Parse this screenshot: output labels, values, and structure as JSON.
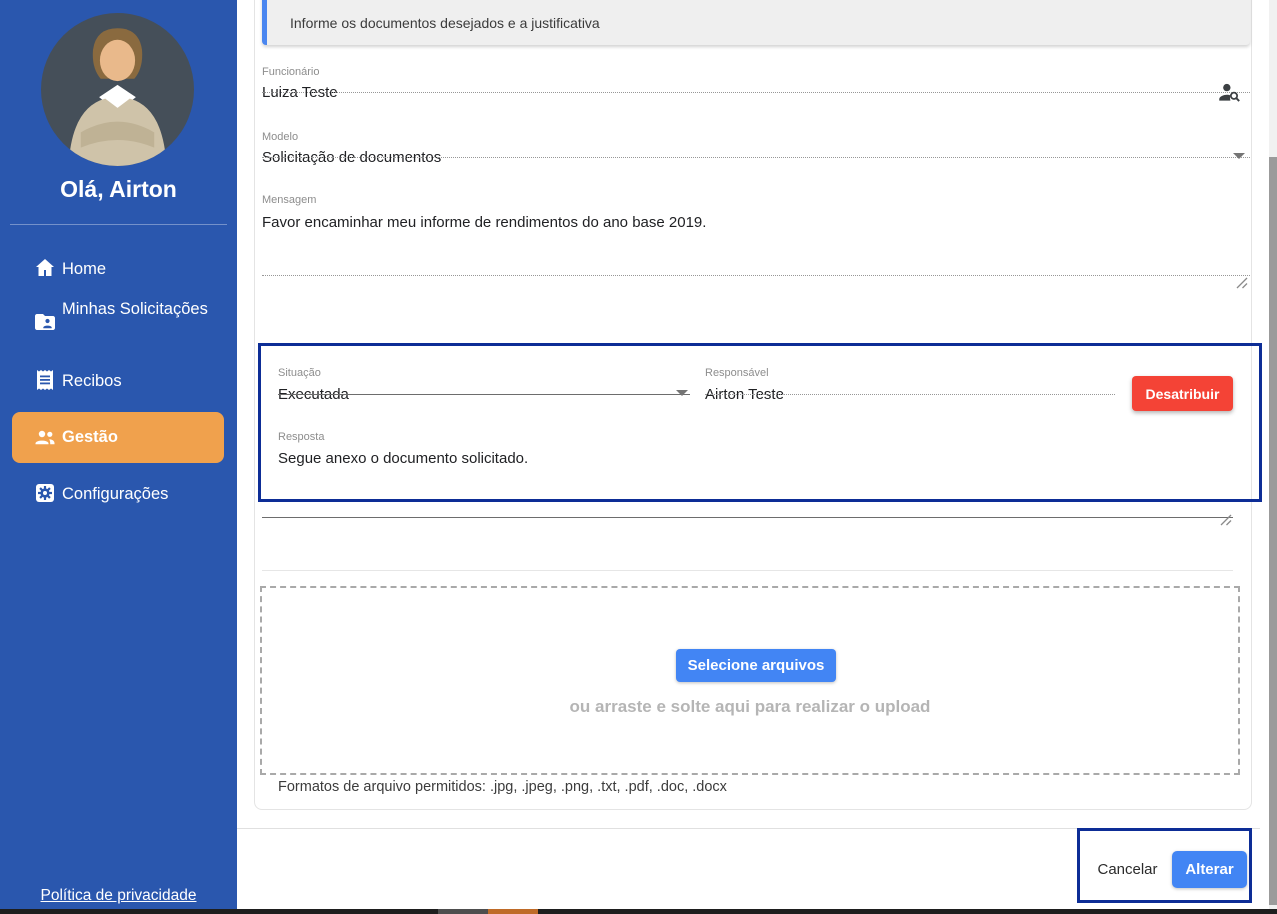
{
  "sidebar": {
    "greeting": "Olá, Airton",
    "items": [
      {
        "label": "Home",
        "icon": "home-icon",
        "active": false
      },
      {
        "label": "Minhas Solicitações",
        "icon": "folder-shared-icon",
        "active": false
      },
      {
        "label": "Recibos",
        "icon": "receipt-icon",
        "active": false
      },
      {
        "label": "Gestão",
        "icon": "people-icon",
        "active": true
      },
      {
        "label": "Configurações",
        "icon": "settings-icon",
        "active": false
      }
    ],
    "privacy_link": "Política de privacidade"
  },
  "banner": {
    "text": "Informe os documentos desejados e a justificativa"
  },
  "form": {
    "funcionario": {
      "label": "Funcionário",
      "value": "Luiza Teste",
      "icon": "person-search-icon"
    },
    "modelo": {
      "label": "Modelo",
      "value": "Solicitação de documentos"
    },
    "mensagem": {
      "label": "Mensagem",
      "value": "Favor encaminhar meu informe de rendimentos do ano base 2019."
    },
    "situacao": {
      "label": "Situação",
      "value": "Executada"
    },
    "responsavel": {
      "label": "Responsável",
      "value": "Airton Teste"
    },
    "desatribuir_label": "Desatribuir",
    "resposta": {
      "label": "Resposta",
      "value": "Segue anexo o documento solicitado."
    }
  },
  "upload": {
    "select_button_label": "Selecione arquivos",
    "drag_text": "ou arraste e solte aqui para realizar o upload",
    "formats_text": "Formatos de arquivo permitidos: .jpg, .jpeg, .png, .txt, .pdf, .doc, .docx"
  },
  "actions": {
    "cancel_label": "Cancelar",
    "submit_label": "Alterar"
  },
  "colors": {
    "sidebar_bg": "#2a57ae",
    "active_item_bg": "#f0a14d",
    "primary_blue": "#4285f4",
    "danger_red": "#f44336",
    "highlight_border": "#0d2d96",
    "banner_bg": "#efefef"
  }
}
